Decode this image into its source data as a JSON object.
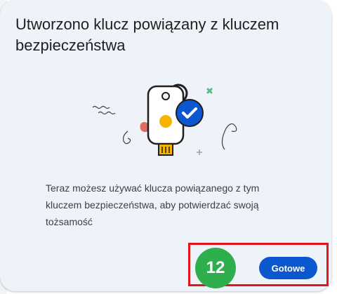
{
  "dialog": {
    "title": "Utworzono klucz powiązany z kluczem bezpieczeństwa",
    "body": "Teraz możesz używać klucza powiązanego z tym kluczem bezpieczeństwa, aby potwierdzać swoją tożsamość",
    "done_label": "Gotowe",
    "illustration": "security-key-with-checkmark",
    "accent_color": "#0b57d0"
  },
  "annotation": {
    "step_number": "12",
    "badge_color": "#2eae4d",
    "box_color": "#e8141c"
  }
}
